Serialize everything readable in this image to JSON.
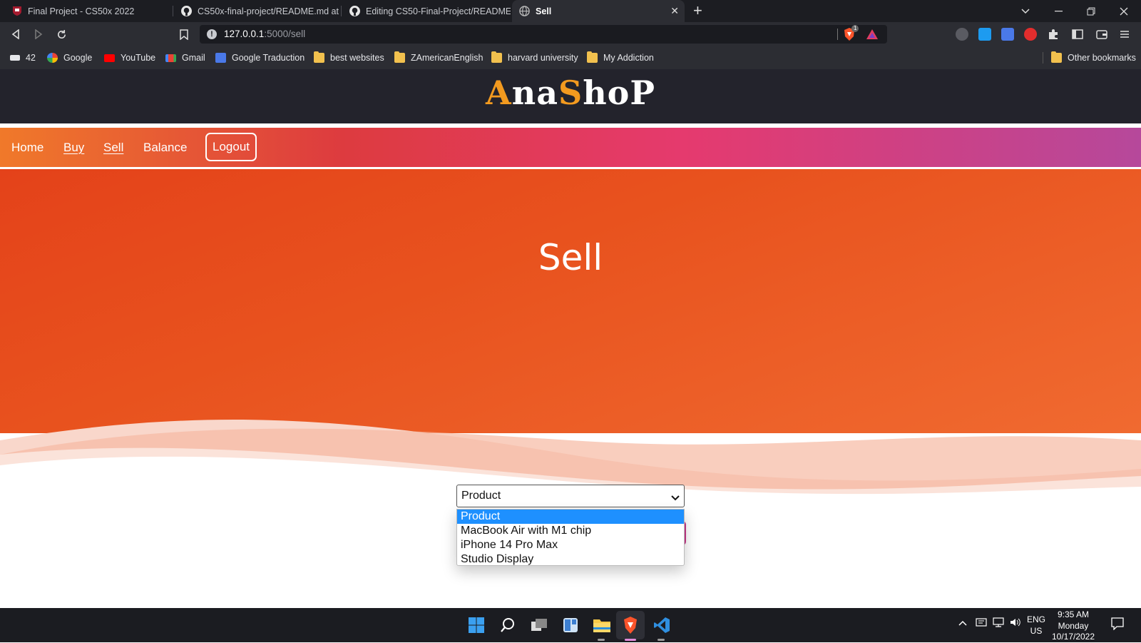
{
  "browser": {
    "tabs": [
      {
        "title": "Final Project - CS50x 2022",
        "active": false
      },
      {
        "title": "CS50x-final-project/README.md at m",
        "active": false
      },
      {
        "title": "Editing CS50-Final-Project/README.m",
        "active": false
      },
      {
        "title": "Sell",
        "active": true
      }
    ],
    "url_host": "127.0.0.1",
    "url_path": ":5000/sell",
    "shield_count": "1",
    "bookmarks": [
      {
        "label": "42",
        "icon": "42-icon"
      },
      {
        "label": "Google",
        "icon": "google-icon"
      },
      {
        "label": "YouTube",
        "icon": "youtube-icon"
      },
      {
        "label": "Gmail",
        "icon": "gmail-icon"
      },
      {
        "label": "Google Traduction",
        "icon": "translate-icon"
      },
      {
        "label": "best websites",
        "icon": "folder-icon"
      },
      {
        "label": "ZAmericanEnglish",
        "icon": "folder-icon"
      },
      {
        "label": "harvard university",
        "icon": "folder-icon"
      },
      {
        "label": "My Addiction",
        "icon": "folder-icon"
      }
    ],
    "other_bookmarks": "Other bookmarks"
  },
  "site": {
    "logo_a": "A",
    "logo_na": "na",
    "logo_s": "S",
    "logo_hop": "hoP",
    "nav": {
      "home": "Home",
      "buy": "Buy",
      "sell": "Sell",
      "balance": "Balance",
      "logout": "Logout"
    },
    "hero_title": "Sell",
    "product_select": {
      "value": "Product",
      "options": [
        "Product",
        "MacBook Air with M1 chip",
        "iPhone 14 Pro Max",
        "Studio Display"
      ],
      "selected_index": 0
    }
  },
  "taskbar": {
    "lang_1": "ENG",
    "lang_2": "US",
    "time": "9:35 AM",
    "day": "Monday",
    "date": "10/17/2022"
  },
  "colors": {
    "accent_orange": "#f39a1f",
    "hero_orange": "#e8521e",
    "header_dark": "#23232c",
    "selected_blue": "#1e90ff"
  }
}
